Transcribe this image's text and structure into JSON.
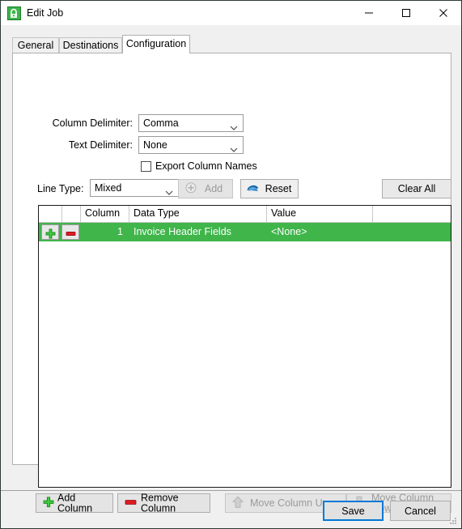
{
  "window": {
    "title": "Edit Job",
    "icon": "app-window-icon",
    "controls": {
      "minimize": "minimize-icon",
      "maximize": "maximize-icon",
      "close": "close-icon"
    }
  },
  "tabs": [
    {
      "label": "General",
      "active": false
    },
    {
      "label": "Destinations",
      "active": false
    },
    {
      "label": "Configuration",
      "active": true
    }
  ],
  "form": {
    "column_delimiter": {
      "label": "Column Delimiter:",
      "value": "Comma"
    },
    "text_delimiter": {
      "label": "Text Delimiter:",
      "value": "None"
    },
    "export_column_names": {
      "label": "Export Column Names",
      "checked": false
    },
    "line_type": {
      "label": "Line Type:",
      "value": "Mixed"
    }
  },
  "toolbar": {
    "add": {
      "label": "Add",
      "icon": "plus-circle-icon",
      "enabled": false
    },
    "reset": {
      "label": "Reset",
      "icon": "reset-arrow-icon",
      "enabled": true
    },
    "clear_all": {
      "label": "Clear All",
      "enabled": true
    }
  },
  "grid": {
    "columns": [
      "",
      "",
      "Column",
      "Data Type",
      "Value",
      ""
    ],
    "rows": [
      {
        "add_icon": "green-plus-icon",
        "remove_icon": "red-minus-icon",
        "column": "1",
        "data_type": "Invoice Header Fields",
        "value": "<None>",
        "selected": true
      }
    ],
    "selection_color": "#3fb54a"
  },
  "actions": {
    "add_column": {
      "label": "Add Column",
      "icon": "green-plus-icon",
      "enabled": true
    },
    "remove_column": {
      "label": "Remove Column",
      "icon": "red-minus-icon",
      "enabled": true
    },
    "move_column_up": {
      "label": "Move Column Up",
      "icon": "up-arrow-icon",
      "enabled": false
    },
    "move_column_down": {
      "label": "Move Column Down",
      "icon": "down-arrow-icon",
      "enabled": false
    }
  },
  "footer": {
    "save": {
      "label": "Save",
      "focused": true
    },
    "cancel": {
      "label": "Cancel",
      "focused": false
    }
  }
}
